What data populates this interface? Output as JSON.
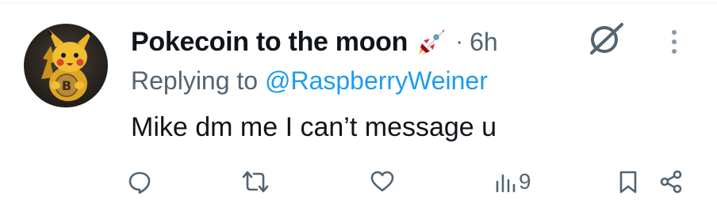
{
  "tweet": {
    "display_name": "Pokecoin to the moon",
    "name_emoji": "rocket-emoji",
    "separator": "·",
    "time": "6h",
    "replying_prefix": "Replying to ",
    "replying_handle": "@RaspberryWeiner",
    "text": "Mike dm me I can’t message u",
    "views": "9"
  },
  "icons": {
    "header": [
      "grok-icon",
      "more-icon"
    ],
    "actions": [
      "reply-icon",
      "retweet-icon",
      "like-icon",
      "views-icon",
      "bookmark-icon",
      "share-icon"
    ]
  },
  "colors": {
    "text": "#0f1419",
    "secondary": "#536471",
    "link": "#1d9bf0"
  }
}
